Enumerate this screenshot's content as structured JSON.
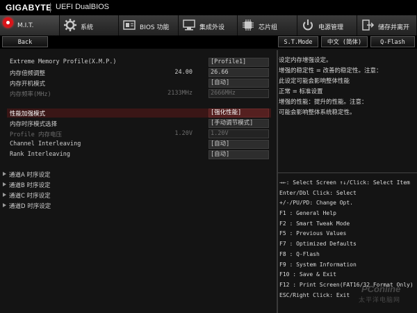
{
  "header": {
    "brand": "GIGABYTE",
    "subtitle": "UEFI DualBIOS"
  },
  "tabs": [
    {
      "label": "M.I.T.",
      "icon": "mit-icon"
    },
    {
      "label": "系统",
      "icon": "gear-icon"
    },
    {
      "label": "BIOS 功能",
      "icon": "bios-icon"
    },
    {
      "label": "集成外设",
      "icon": "peripherals-icon"
    },
    {
      "label": "芯片组",
      "icon": "chipset-icon"
    },
    {
      "label": "电源管理",
      "icon": "power-icon"
    },
    {
      "label": "储存并离开",
      "icon": "exit-icon"
    }
  ],
  "subbar": {
    "back": "Back",
    "st_mode": "S.T.Mode",
    "language": "中文 (简体)",
    "qflash": "Q-Flash"
  },
  "settings": [
    {
      "label": "Extreme Memory Profile(X.M.P.)",
      "current": "",
      "value": "[Profile1]"
    },
    {
      "label": "内存倍频调整",
      "current": "24.00",
      "value": "26.66"
    },
    {
      "label": "内存开机模式",
      "current": "",
      "value": "[自动]"
    },
    {
      "label": "内存频率(MHz)",
      "current": "2133MHz",
      "value": "2666MHz"
    },
    {
      "label": "性能加强模式",
      "current": "",
      "value": "[强化性能]"
    },
    {
      "label": "内存时序模式选择",
      "current": "",
      "value": "[手动调节模式]"
    },
    {
      "label": "Profile 内存电压",
      "current": "1.20V",
      "value": "1.20V"
    },
    {
      "label": "Channel Interleaving",
      "current": "",
      "value": "[自动]"
    },
    {
      "label": "Rank Interleaving",
      "current": "",
      "value": "[自动]"
    }
  ],
  "groups": [
    "通道A 时序设定",
    "通道B 时序设定",
    "通道C 时序设定",
    "通道D 时序设定"
  ],
  "help_text": [
    "设定内存增强设定。",
    "增强的稳定性 = 改善的稳定性。注意：",
    "此设定可能会影响整体性能",
    "正常 = 标准设置",
    "增强的性能：提升的性能。注意：",
    "可能会影响整体系统稳定性。"
  ],
  "key_help": [
    "→←: Select Screen  ↑↓/Click: Select Item",
    "Enter/Dbl Click: Select",
    "+/-/PU/PD: Change Opt.",
    "F1  : General Help",
    "F2  : Smart Tweak Mode",
    "F5  : Previous Values",
    "F7  : Optimized Defaults",
    "F8  : Q-Flash",
    "F9  : System Information",
    "F10 : Save & Exit",
    "F12 : Print Screen(FAT16/32 Format Only)",
    "ESC/Right Click: Exit"
  ],
  "watermark": {
    "line1": "PConline",
    "line2": "太平洋电脑网"
  },
  "colors": {
    "accent_red": "#d8151a",
    "highlight": "#552020",
    "background": "#141414"
  }
}
